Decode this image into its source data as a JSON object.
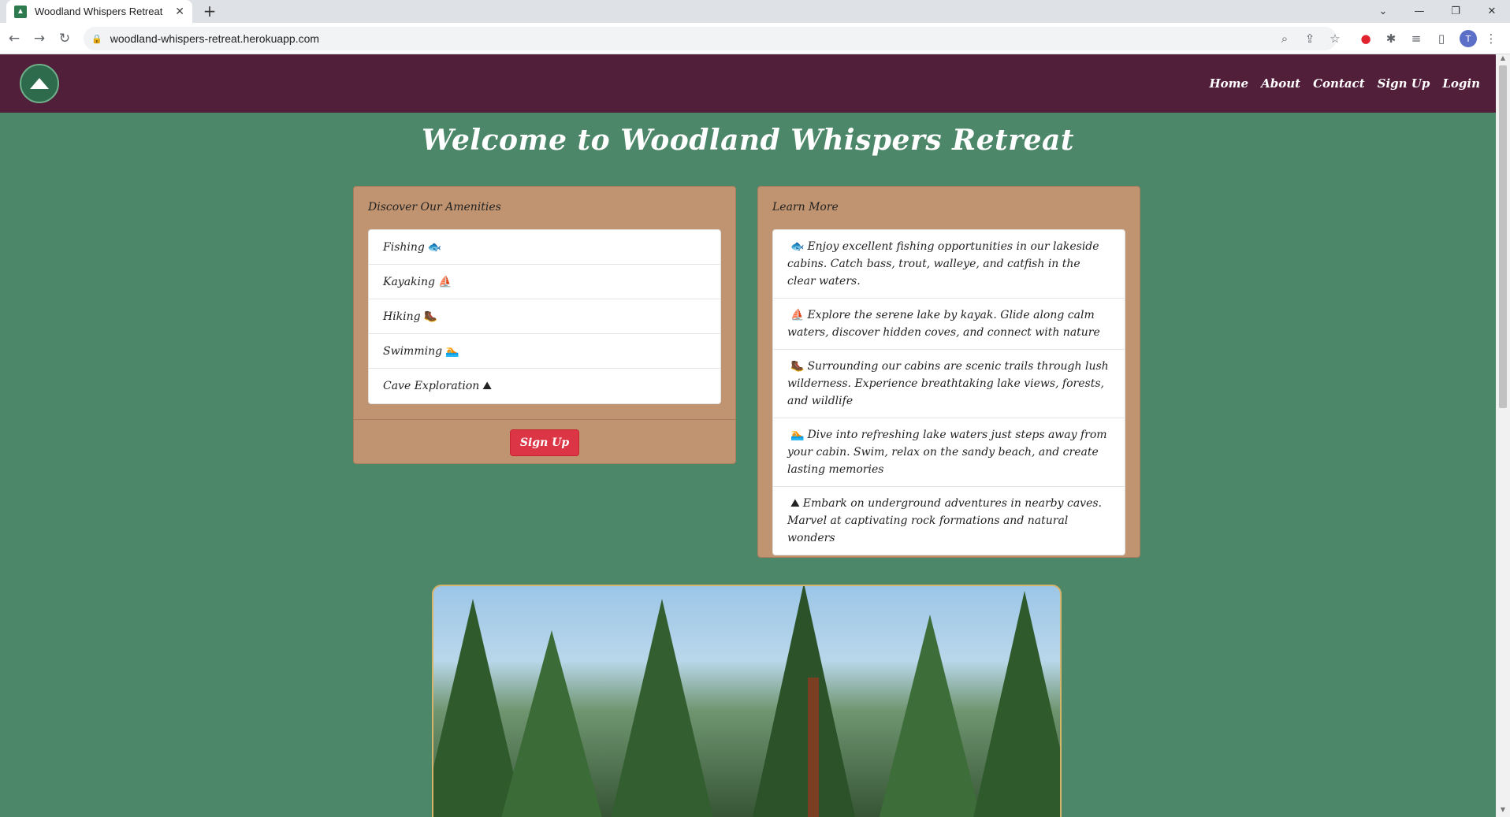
{
  "browser": {
    "tab_title": "Woodland Whispers Retreat",
    "url": "woodland-whispers-retreat.herokuapp.com",
    "profile_initial": "T"
  },
  "site": {
    "nav": [
      "Home",
      "About",
      "Contact",
      "Sign Up",
      "Login"
    ],
    "heading": "Welcome to Woodland Whispers Retreat"
  },
  "amenities": {
    "title": "Discover Our Amenities",
    "items": [
      {
        "label": "Fishing",
        "icon": "🐟"
      },
      {
        "label": "Kayaking",
        "icon": "⛵"
      },
      {
        "label": "Hiking",
        "icon": "🥾"
      },
      {
        "label": "Swimming",
        "icon": "🏊"
      },
      {
        "label": "Cave Exploration",
        "icon": "⛰"
      }
    ],
    "button": "Sign Up"
  },
  "learn_more": {
    "title": "Learn More",
    "items": [
      {
        "icon": "🐟",
        "text": "Enjoy excellent fishing opportunities in our lakeside cabins. Catch bass, trout, walleye, and catfish in the clear waters."
      },
      {
        "icon": "⛵",
        "text": "Explore the serene lake by kayak. Glide along calm waters, discover hidden coves, and connect with nature"
      },
      {
        "icon": "🥾",
        "text": "Surrounding our cabins are scenic trails through lush wilderness. Experience breathtaking lake views, forests, and wildlife"
      },
      {
        "icon": "🏊",
        "text": "Dive into refreshing lake waters just steps away from your cabin. Swim, relax on the sandy beach, and create lasting memories"
      },
      {
        "icon": "⛰",
        "text": "Embark on underground adventures in nearby caves. Marvel at captivating rock formations and natural wonders"
      }
    ]
  },
  "colors": {
    "page_bg": "#4c8769",
    "nav_bg": "#521f3b",
    "card_bg": "#c09470",
    "button_bg": "#dc3545"
  }
}
